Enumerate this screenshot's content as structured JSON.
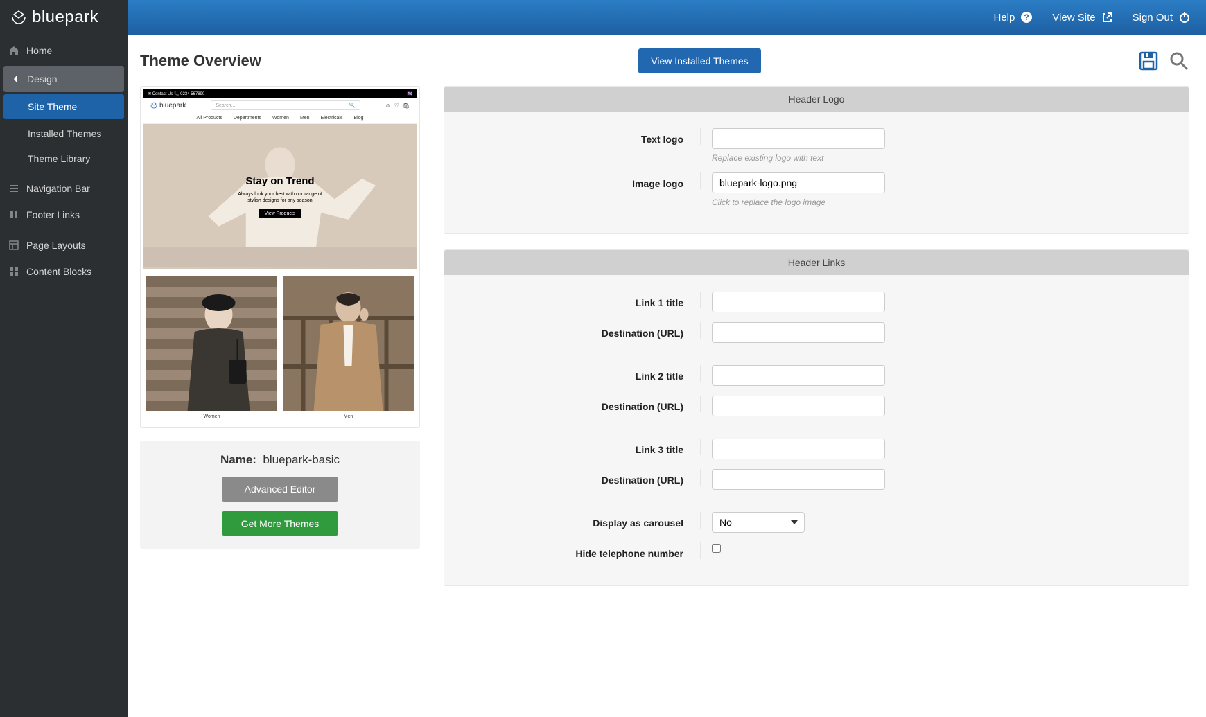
{
  "brand": "bluepark",
  "topbar": {
    "help": "Help",
    "view_site": "View Site",
    "sign_out": "Sign Out"
  },
  "sidebar": {
    "home": "Home",
    "design": "Design",
    "site_theme": "Site Theme",
    "installed_themes": "Installed Themes",
    "theme_library": "Theme Library",
    "navigation_bar": "Navigation Bar",
    "footer_links": "Footer Links",
    "page_layouts": "Page Layouts",
    "content_blocks": "Content Blocks"
  },
  "page": {
    "title": "Theme Overview",
    "view_installed_btn": "View Installed Themes"
  },
  "preview": {
    "topbar_left": "✉ Contact Us   📞 0234 567890",
    "topbar_right_flag": "🇬🇧",
    "logo": "bluepark",
    "search_placeholder": "Search...",
    "nav": [
      "All Products",
      "Departments",
      "Women",
      "Men",
      "Electricals",
      "Blog"
    ],
    "hero_title": "Stay on Trend",
    "hero_sub1": "Always look your best with our range of",
    "hero_sub2": "stylish designs for any season",
    "hero_btn": "View Products",
    "duo_left": "Women",
    "duo_right": "Men"
  },
  "name_panel": {
    "label": "Name:",
    "value": "bluepark-basic",
    "advanced_btn": "Advanced Editor",
    "get_more_btn": "Get More Themes"
  },
  "header_logo_panel": {
    "title": "Header Logo",
    "text_logo_label": "Text logo",
    "text_logo_value": "",
    "text_logo_hint": "Replace existing logo with text",
    "image_logo_label": "Image logo",
    "image_logo_value": "bluepark-logo.png",
    "image_logo_hint": "Click to replace the logo image"
  },
  "header_links_panel": {
    "title": "Header Links",
    "link1_title_label": "Link 1 title",
    "link1_title_value": "",
    "link1_url_label": "Destination (URL)",
    "link1_url_value": "",
    "link2_title_label": "Link 2 title",
    "link2_title_value": "",
    "link2_url_label": "Destination (URL)",
    "link2_url_value": "",
    "link3_title_label": "Link 3 title",
    "link3_title_value": "",
    "link3_url_label": "Destination (URL)",
    "link3_url_value": "",
    "carousel_label": "Display as carousel",
    "carousel_value": "No",
    "hide_tel_label": "Hide telephone number"
  }
}
